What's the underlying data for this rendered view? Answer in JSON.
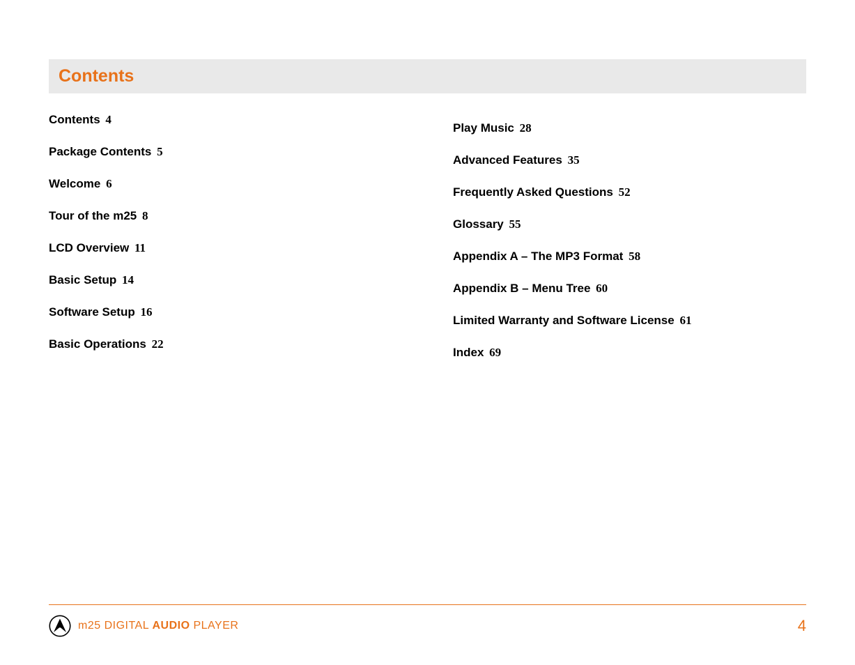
{
  "header": {
    "title": "Contents"
  },
  "toc": {
    "left": [
      {
        "label": "Contents",
        "page": "4"
      },
      {
        "label": "Package Contents",
        "page": "5"
      },
      {
        "label": "Welcome",
        "page": "6"
      },
      {
        "label": "Tour of the m25",
        "page": "8"
      },
      {
        "label": "LCD Overview",
        "page": "11"
      },
      {
        "label": "Basic Setup",
        "page": "14"
      },
      {
        "label": "Software Setup",
        "page": "16"
      },
      {
        "label": "Basic Operations",
        "page": "22"
      }
    ],
    "right": [
      {
        "label": "Play Music",
        "page": "28"
      },
      {
        "label": "Advanced Features",
        "page": "35"
      },
      {
        "label": "Frequently Asked Questions",
        "page": "52"
      },
      {
        "label": "Glossary",
        "page": "55"
      },
      {
        "label": "Appendix A – The MP3 Format",
        "page": "58"
      },
      {
        "label": "Appendix B – Menu Tree",
        "page": "60"
      },
      {
        "label": "Limited Warranty and Software License",
        "page": "61"
      },
      {
        "label": "Index",
        "page": "69"
      }
    ]
  },
  "footer": {
    "product_prefix": "m25 DIGITAL ",
    "product_bold": "AUDIO",
    "product_suffix": " PLAYER",
    "page_number": "4"
  }
}
